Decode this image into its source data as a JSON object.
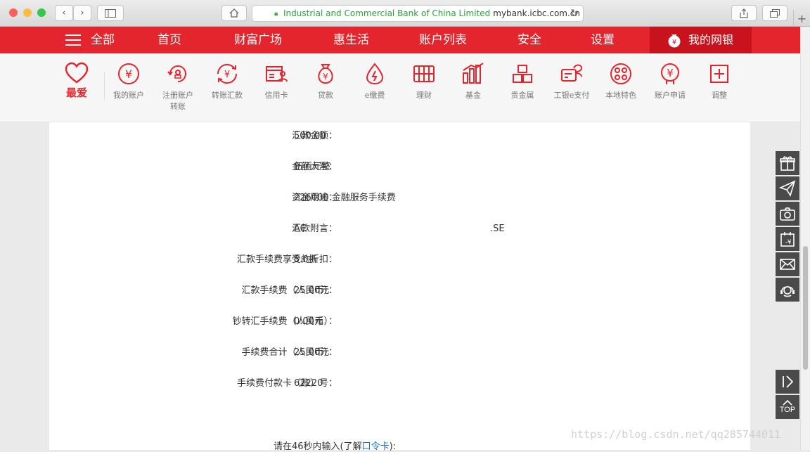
{
  "browser": {
    "url_org": "Industrial and Commercial Bank of China Limited",
    "url_domain": "mybank.icbc.com.cn"
  },
  "nav": {
    "menu_all": "全部",
    "items": [
      "首页",
      "财富广场",
      "惠生活",
      "账户列表",
      "安全",
      "设置"
    ],
    "mybank": "我的网银"
  },
  "shortcuts": {
    "favorite": "最爱",
    "items": [
      {
        "label": "我的账户",
        "icon": "yen-circle-icon"
      },
      {
        "label": "注册账户\n转账",
        "icon": "transfer-register-icon"
      },
      {
        "label": "转账汇款",
        "icon": "remit-icon"
      },
      {
        "label": "信用卡",
        "icon": "credit-card-icon"
      },
      {
        "label": "贷款",
        "icon": "money-bag-icon"
      },
      {
        "label": "e缴费",
        "icon": "droplet-icon"
      },
      {
        "label": "理财",
        "icon": "abacus-icon"
      },
      {
        "label": "基金",
        "icon": "bar-chart-icon"
      },
      {
        "label": "贵金属",
        "icon": "gold-bars-icon"
      },
      {
        "label": "工银e支付",
        "icon": "epay-icon"
      },
      {
        "label": "本地特色",
        "icon": "local-icon"
      },
      {
        "label": "账户申请",
        "icon": "apply-icon"
      },
      {
        "label": "调整",
        "icon": "plus-square-icon"
      }
    ]
  },
  "form": {
    "rows": [
      {
        "label": "汇款金额：",
        "value": "500.00"
      },
      {
        "label": "金额大写：",
        "value": "伍佰元整"
      },
      {
        "label": "资金用途：",
        "value": "226000 金融服务手续费"
      },
      {
        "label": "汇款附言：",
        "value": "AC",
        "value_tail": ".SE"
      },
      {
        "label": "汇款手续费享受的折扣：",
        "value": "5.0折"
      },
      {
        "label": "汇款手续费（人民币）：",
        "value": "25.00元"
      },
      {
        "label": "钞转汇手续费（人民币）：",
        "value": "0.00元"
      },
      {
        "label": "手续费合计（人民币）：",
        "value": "25.00元"
      },
      {
        "label": "手续费付款卡（账）号：",
        "value": "62220"
      }
    ],
    "prompt_prefix": "请在46秒内输入(了解",
    "prompt_link": "口令卡",
    "prompt_suffix": "):"
  },
  "rail": {
    "top_label": "TOP"
  },
  "watermark": "https://blog.csdn.net/qq285744011",
  "colors": {
    "brand_red": "#e5252d",
    "mybank_red": "#c8121d",
    "rail_gray": "#4a4a4a"
  }
}
